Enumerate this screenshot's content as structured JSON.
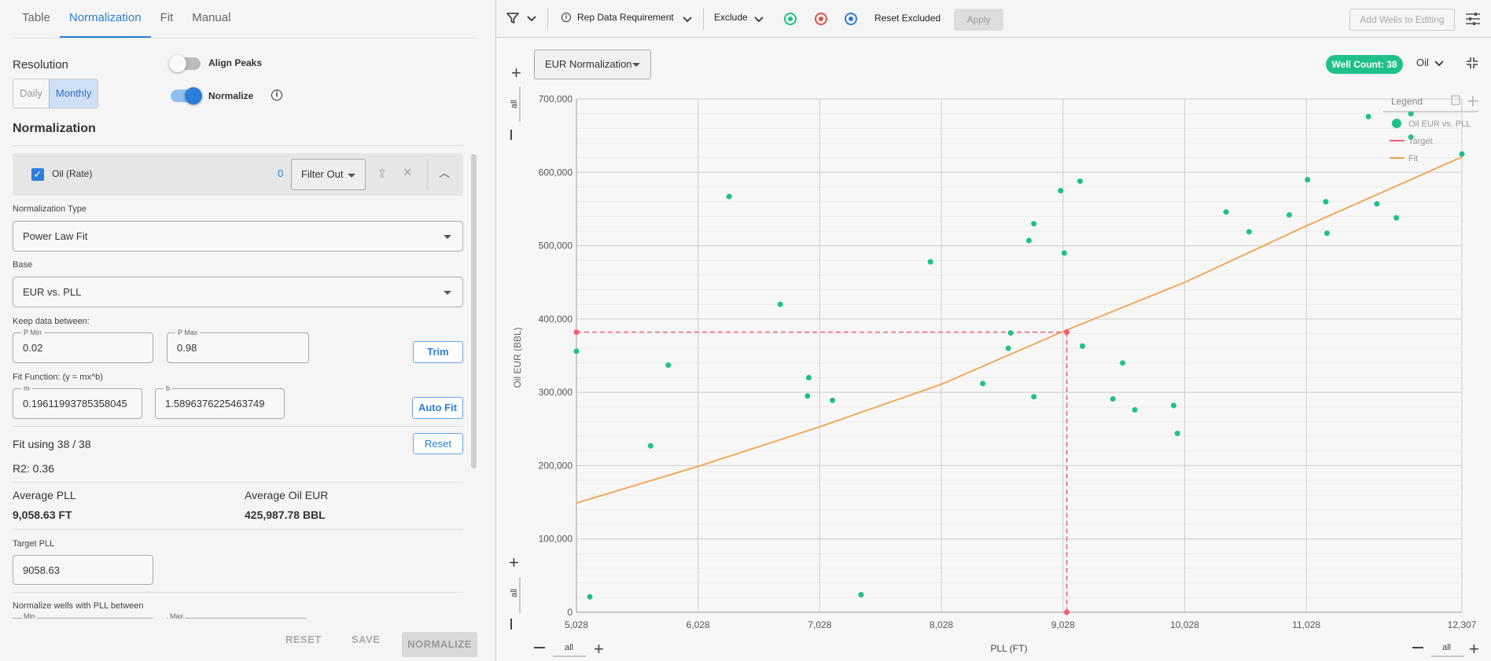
{
  "tabs": [
    "Table",
    "Normalization",
    "Fit",
    "Manual"
  ],
  "left": {
    "resolution_label": "Resolution",
    "resolution_options": [
      "Daily",
      "Monthly"
    ],
    "align_peaks_label": "Align Peaks",
    "normalize_label": "Normalize",
    "normalization_heading": "Normalization",
    "oil_rate_label": "Oil (Rate)",
    "oil_count": "0",
    "filter_out_label": "Filter Out",
    "norm_type_label": "Normalization Type",
    "norm_type_value": "Power Law Fit",
    "base_label": "Base",
    "base_value": "EUR vs. PLL",
    "keep_between_label": "Keep data between:",
    "pmin_label": "P Min",
    "pmin_value": "0.02",
    "pmax_label": "P Max",
    "pmax_value": "0.98",
    "trim_label": "Trim",
    "fit_function_label": "Fit Function: (y = mx^b)",
    "m_label": "m",
    "m_value": "0.19611993785358045",
    "b_label": "b",
    "b_value": "1.5896376225463749",
    "auto_fit_label": "Auto Fit",
    "fit_using": "Fit using 38 / 38",
    "reset_label": "Reset",
    "r2": "R2: 0.36",
    "avg_pll_label": "Average PLL",
    "avg_pll_value": "9,058.63 FT",
    "avg_eur_label": "Average Oil EUR",
    "avg_eur_value": "425,987.78 BBL",
    "target_pll_label": "Target PLL",
    "target_pll_value": "9058.63",
    "normalize_between_label": "Normalize wells with PLL between",
    "min_label": "Min",
    "max_label": "Max",
    "footer_reset": "RESET",
    "footer_save": "SAVE",
    "footer_normalize": "NORMALIZE"
  },
  "toolbar": {
    "rep_data": "Rep Data Requirement",
    "exclude": "Exclude",
    "reset_excluded": "Reset Excluded",
    "apply": "Apply",
    "add_wells": "Add Wells to Editing",
    "radio_colors": [
      "#20c08a",
      "#e0534a",
      "#2d7ed8"
    ]
  },
  "chart_header": {
    "dropdown": "EUR Normalization",
    "well_count": "Well Count: 38",
    "product": "Oil",
    "all_label": "all"
  },
  "chart_data": {
    "type": "scatter",
    "xlabel": "PLL (FT)",
    "ylabel": "Oil EUR (BBL)",
    "xlim": [
      5028,
      12307
    ],
    "ylim": [
      0,
      700000
    ],
    "x_ticks": [
      "5,028",
      "6,028",
      "7,028",
      "8,028",
      "9,028",
      "10,028",
      "11,028",
      "12,307"
    ],
    "x_tick_values": [
      5028,
      6028,
      7028,
      8028,
      9028,
      10028,
      11028,
      12307
    ],
    "y_ticks": [
      "0",
      "100,000",
      "200,000",
      "300,000",
      "400,000",
      "500,000",
      "600,000",
      "700,000"
    ],
    "y_tick_values": [
      0,
      100000,
      200000,
      300000,
      400000,
      500000,
      600000,
      700000
    ],
    "legend": {
      "title": "Legend",
      "items": [
        "Oil EUR vs. PLL",
        "Target",
        "Fit"
      ],
      "position": "top-right"
    },
    "colors": {
      "points": "#20c08a",
      "target": "#f0607a",
      "fit": "#f5a04a"
    },
    "target": {
      "x": 9058.63,
      "y": 382000
    },
    "fit_line": [
      [
        5028,
        149000
      ],
      [
        6028,
        199000
      ],
      [
        7028,
        253000
      ],
      [
        8028,
        311000
      ],
      [
        9028,
        383000
      ],
      [
        10028,
        450000
      ],
      [
        11028,
        527000
      ],
      [
        12307,
        621000
      ]
    ],
    "points": [
      [
        5028,
        356000
      ],
      [
        5138,
        21000
      ],
      [
        5638,
        227000
      ],
      [
        5783,
        337000
      ],
      [
        6283,
        567000
      ],
      [
        6703,
        420000
      ],
      [
        6928,
        295000
      ],
      [
        6938,
        320000
      ],
      [
        7133,
        289000
      ],
      [
        7368,
        24000
      ],
      [
        7938,
        478000
      ],
      [
        8368,
        312000
      ],
      [
        8578,
        360000
      ],
      [
        8598,
        381000
      ],
      [
        8748,
        507000
      ],
      [
        8788,
        530000
      ],
      [
        8788,
        294000
      ],
      [
        9008,
        575000
      ],
      [
        9038,
        490000
      ],
      [
        9168,
        588000
      ],
      [
        9188,
        363000
      ],
      [
        9438,
        291000
      ],
      [
        9518,
        340000
      ],
      [
        9618,
        276000
      ],
      [
        9938,
        282000
      ],
      [
        9968,
        244000
      ],
      [
        10368,
        546000
      ],
      [
        10558,
        519000
      ],
      [
        10888,
        542000
      ],
      [
        11038,
        590000
      ],
      [
        11188,
        560000
      ],
      [
        11198,
        517000
      ],
      [
        11538,
        676000
      ],
      [
        11608,
        557000
      ],
      [
        11768,
        538000
      ],
      [
        11888,
        680000
      ],
      [
        11888,
        648000
      ],
      [
        12307,
        625000
      ]
    ]
  }
}
